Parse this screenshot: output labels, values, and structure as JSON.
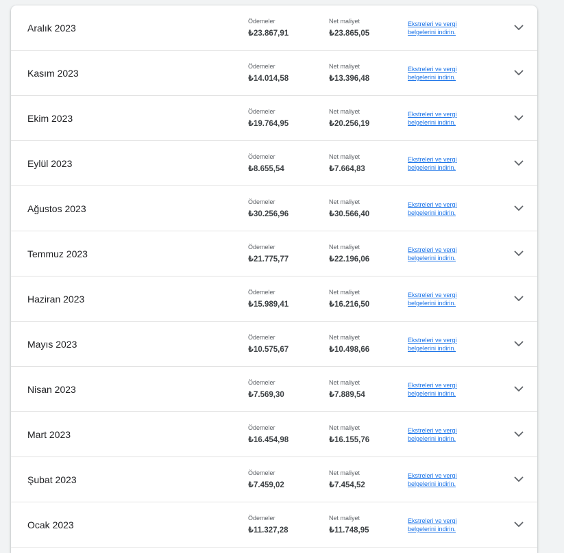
{
  "statements": {
    "payments_label": "Ödemeler",
    "net_cost_label": "Net maliyet",
    "download_link_line1": "Ekstreleri ve vergi",
    "download_link_line2": "belgelerini indirin.",
    "rows": [
      {
        "month": "Aralık 2023",
        "payments": "₺23.867,91",
        "net_cost": "₺23.865,05"
      },
      {
        "month": "Kasım 2023",
        "payments": "₺14.014,58",
        "net_cost": "₺13.396,48"
      },
      {
        "month": "Ekim 2023",
        "payments": "₺19.764,95",
        "net_cost": "₺20.256,19"
      },
      {
        "month": "Eylül 2023",
        "payments": "₺8.655,54",
        "net_cost": "₺7.664,83"
      },
      {
        "month": "Ağustos 2023",
        "payments": "₺30.256,96",
        "net_cost": "₺30.566,40"
      },
      {
        "month": "Temmuz 2023",
        "payments": "₺21.775,77",
        "net_cost": "₺22.196,06"
      },
      {
        "month": "Haziran 2023",
        "payments": "₺15.989,41",
        "net_cost": "₺16.216,50"
      },
      {
        "month": "Mayıs 2023",
        "payments": "₺10.575,67",
        "net_cost": "₺10.498,66"
      },
      {
        "month": "Nisan 2023",
        "payments": "₺7.569,30",
        "net_cost": "₺7.889,54"
      },
      {
        "month": "Mart 2023",
        "payments": "₺16.454,98",
        "net_cost": "₺16.155,76"
      },
      {
        "month": "Şubat 2023",
        "payments": "₺7.459,02",
        "net_cost": "₺7.454,52"
      },
      {
        "month": "Ocak 2023",
        "payments": "₺11.327,28",
        "net_cost": "₺11.748,95"
      }
    ]
  },
  "icons": {
    "expand": "chevron-down-icon"
  },
  "colors": {
    "link": "#1a73e8",
    "text": "#202124",
    "label": "#5f6368",
    "background": "#f1f3f4"
  }
}
